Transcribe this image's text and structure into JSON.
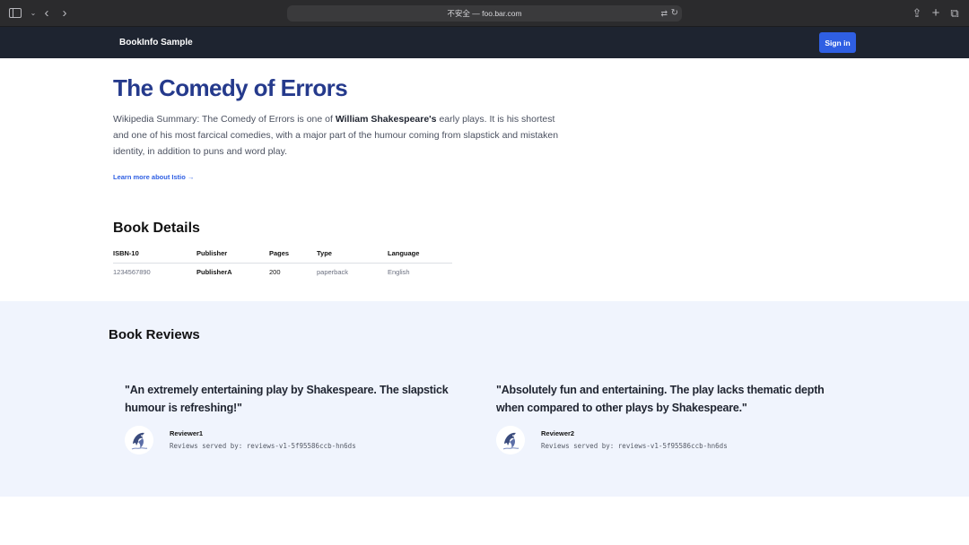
{
  "browser": {
    "url": "不安全 — foo.bar.com"
  },
  "nav": {
    "brand": "BookInfo Sample",
    "signin_label": "Sign in"
  },
  "product": {
    "title": "The Comedy of Errors",
    "summary_prefix": "Wikipedia Summary: The Comedy of Errors is one of ",
    "summary_author": "William Shakespeare's",
    "summary_suffix": " early plays. It is his shortest and one of his most farcical comedies, with a major part of the humour coming from slapstick and mistaken identity, in addition to puns and word play.",
    "learn_more": "Learn more about Istio →"
  },
  "details": {
    "heading": "Book Details",
    "columns": [
      "ISBN-10",
      "Publisher",
      "Pages",
      "Type",
      "Language"
    ],
    "row": [
      "1234567890",
      "PublisherA",
      "200",
      "paperback",
      "English"
    ]
  },
  "reviews": {
    "heading": "Book Reviews",
    "items": [
      {
        "quote": "\"An extremely entertaining play by Shakespeare. The slapstick humour is refreshing!\"",
        "reviewer": "Reviewer1",
        "served_by": "Reviews served by: reviews-v1-5f95586ccb-hn6ds"
      },
      {
        "quote": "\"Absolutely fun and entertaining. The play lacks thematic depth when compared to other plays by Shakespeare.\"",
        "reviewer": "Reviewer2",
        "served_by": "Reviews served by: reviews-v1-5f95586ccb-hn6ds"
      }
    ]
  },
  "colors": {
    "title": "#253a8c",
    "accent": "#2f5fe3",
    "navbar": "#1e2430",
    "reviews_bg": "#f0f4fd"
  }
}
